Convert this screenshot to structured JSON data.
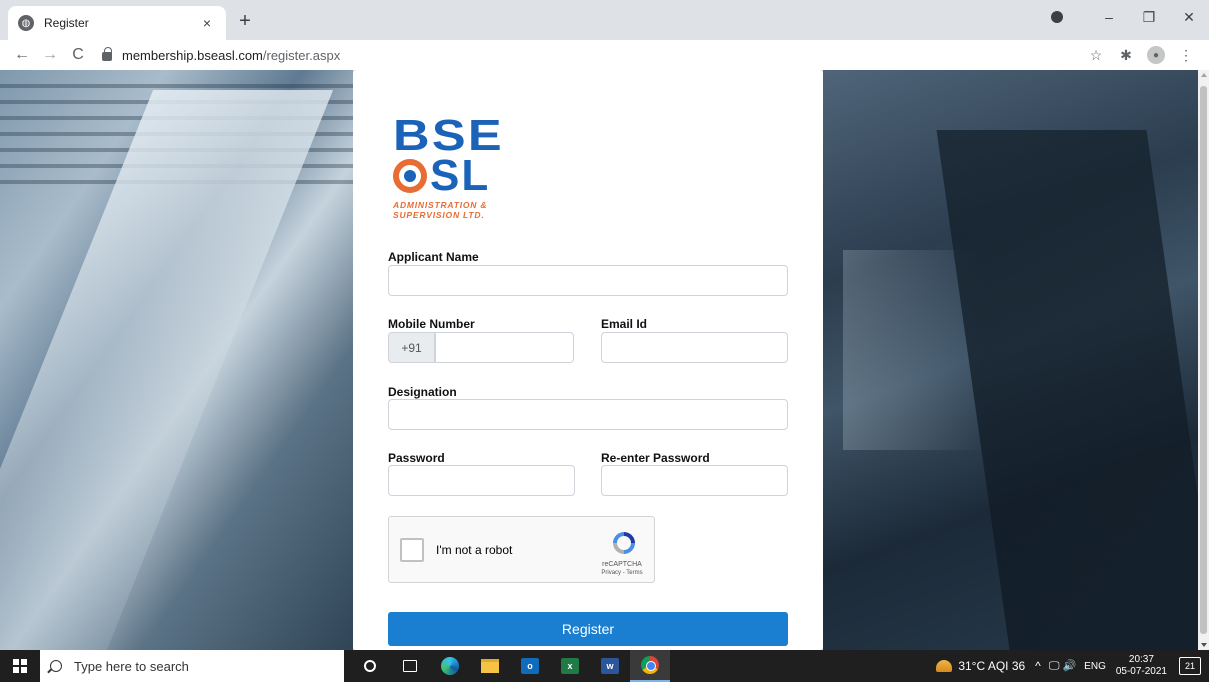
{
  "browser": {
    "tab_title": "Register",
    "tab_close": "×",
    "new_tab": "+",
    "url_host": "membership.bseasl.com",
    "url_path": "/register.aspx",
    "back": "←",
    "forward": "→",
    "reload": "C",
    "star": "☆",
    "extensions": "✱",
    "menu": "⋮",
    "minimize": "–",
    "restore": "❐",
    "close": "✕"
  },
  "logo": {
    "line1": "BSE",
    "line2": "SL",
    "sub1": "ADMINISTRATION &",
    "sub2": "SUPERVISION LTD.",
    "colors": {
      "blue": "#1b63b8",
      "orange": "#e86d34"
    }
  },
  "form": {
    "applicant_name_label": "Applicant Name",
    "applicant_name_value": "",
    "mobile_label": "Mobile Number",
    "mobile_prefix": "+91",
    "mobile_value": "",
    "email_label": "Email Id",
    "email_value": "",
    "designation_label": "Designation",
    "designation_value": "",
    "password_label": "Password",
    "password_value": "",
    "reenter_password_label": "Re-enter Password",
    "reenter_password_value": "",
    "captcha": {
      "label": "I'm not a robot",
      "brand": "reCAPTCHA",
      "terms": "Privacy - Terms"
    },
    "register_button": "Register",
    "accent_color": "#1a7fd0"
  },
  "taskbar": {
    "search_placeholder": "Type here to search",
    "outlook_letter": "o",
    "excel_letter": "x",
    "word_letter": "w",
    "weather": "31°C  AQI 36",
    "chevron": "^",
    "sys_icons": "🖵 🔊",
    "language": "ENG",
    "time": "20:37",
    "date": "05-07-2021",
    "notifications": "21"
  }
}
